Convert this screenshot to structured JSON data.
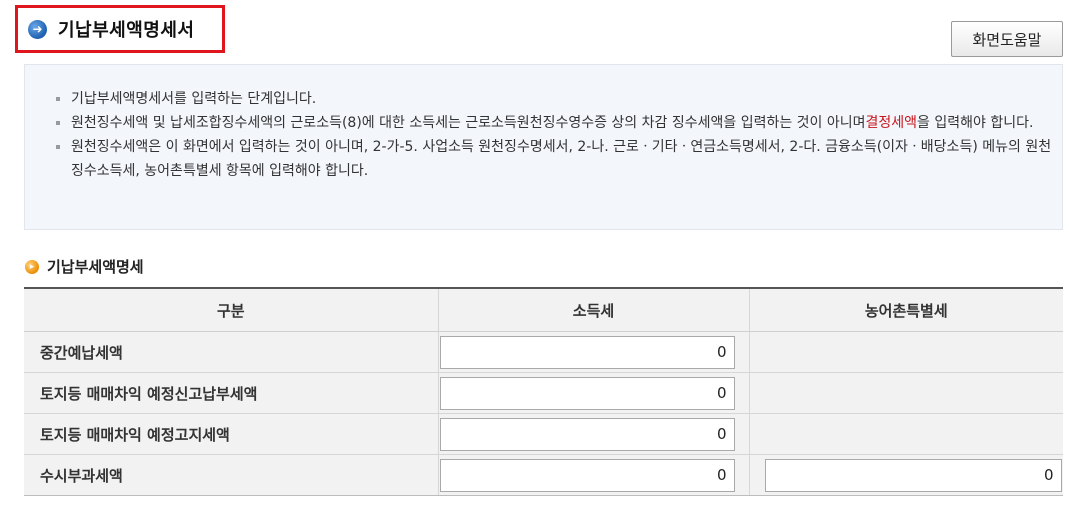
{
  "page": {
    "title": "기납부세액명세서",
    "help_button": "화면도움말"
  },
  "info": {
    "line1": "기납부세액명세서를 입력하는 단계입니다.",
    "line2_pre": "원천징수세액 및 납세조합징수세액의 근로소득(8)에 대한 소득세는 근로소득원천징수영수증 상의 차감 징수세액을 입력하는 것이 아니며",
    "line2_red": "결정세액",
    "line2_post": "을 입력해야 합니다.",
    "line3": "원천징수세액은 이 화면에서 입력하는 것이 아니며, 2-가-5. 사업소득 원천징수명세서, 2-나. 근로ㆍ기타ㆍ연금소득명세서, 2-다. 금융소득(이자ㆍ배당소득) 메뉴의 원천징수소득세, 농어촌특별세 항목에 입력해야 합니다."
  },
  "section": {
    "title": "기납부세액명세"
  },
  "table": {
    "headers": [
      "구분",
      "소득세",
      "농어촌특별세"
    ],
    "rows": [
      {
        "label": "중간예납세액",
        "income_tax": "0",
        "rural_tax": null
      },
      {
        "label": "토지등 매매차익 예정신고납부세액",
        "income_tax": "0",
        "rural_tax": null
      },
      {
        "label": "토지등 매매차익 예정고지세액",
        "income_tax": "0",
        "rural_tax": null
      },
      {
        "label": "수시부과세액",
        "income_tax": "0",
        "rural_tax": "0"
      }
    ]
  }
}
